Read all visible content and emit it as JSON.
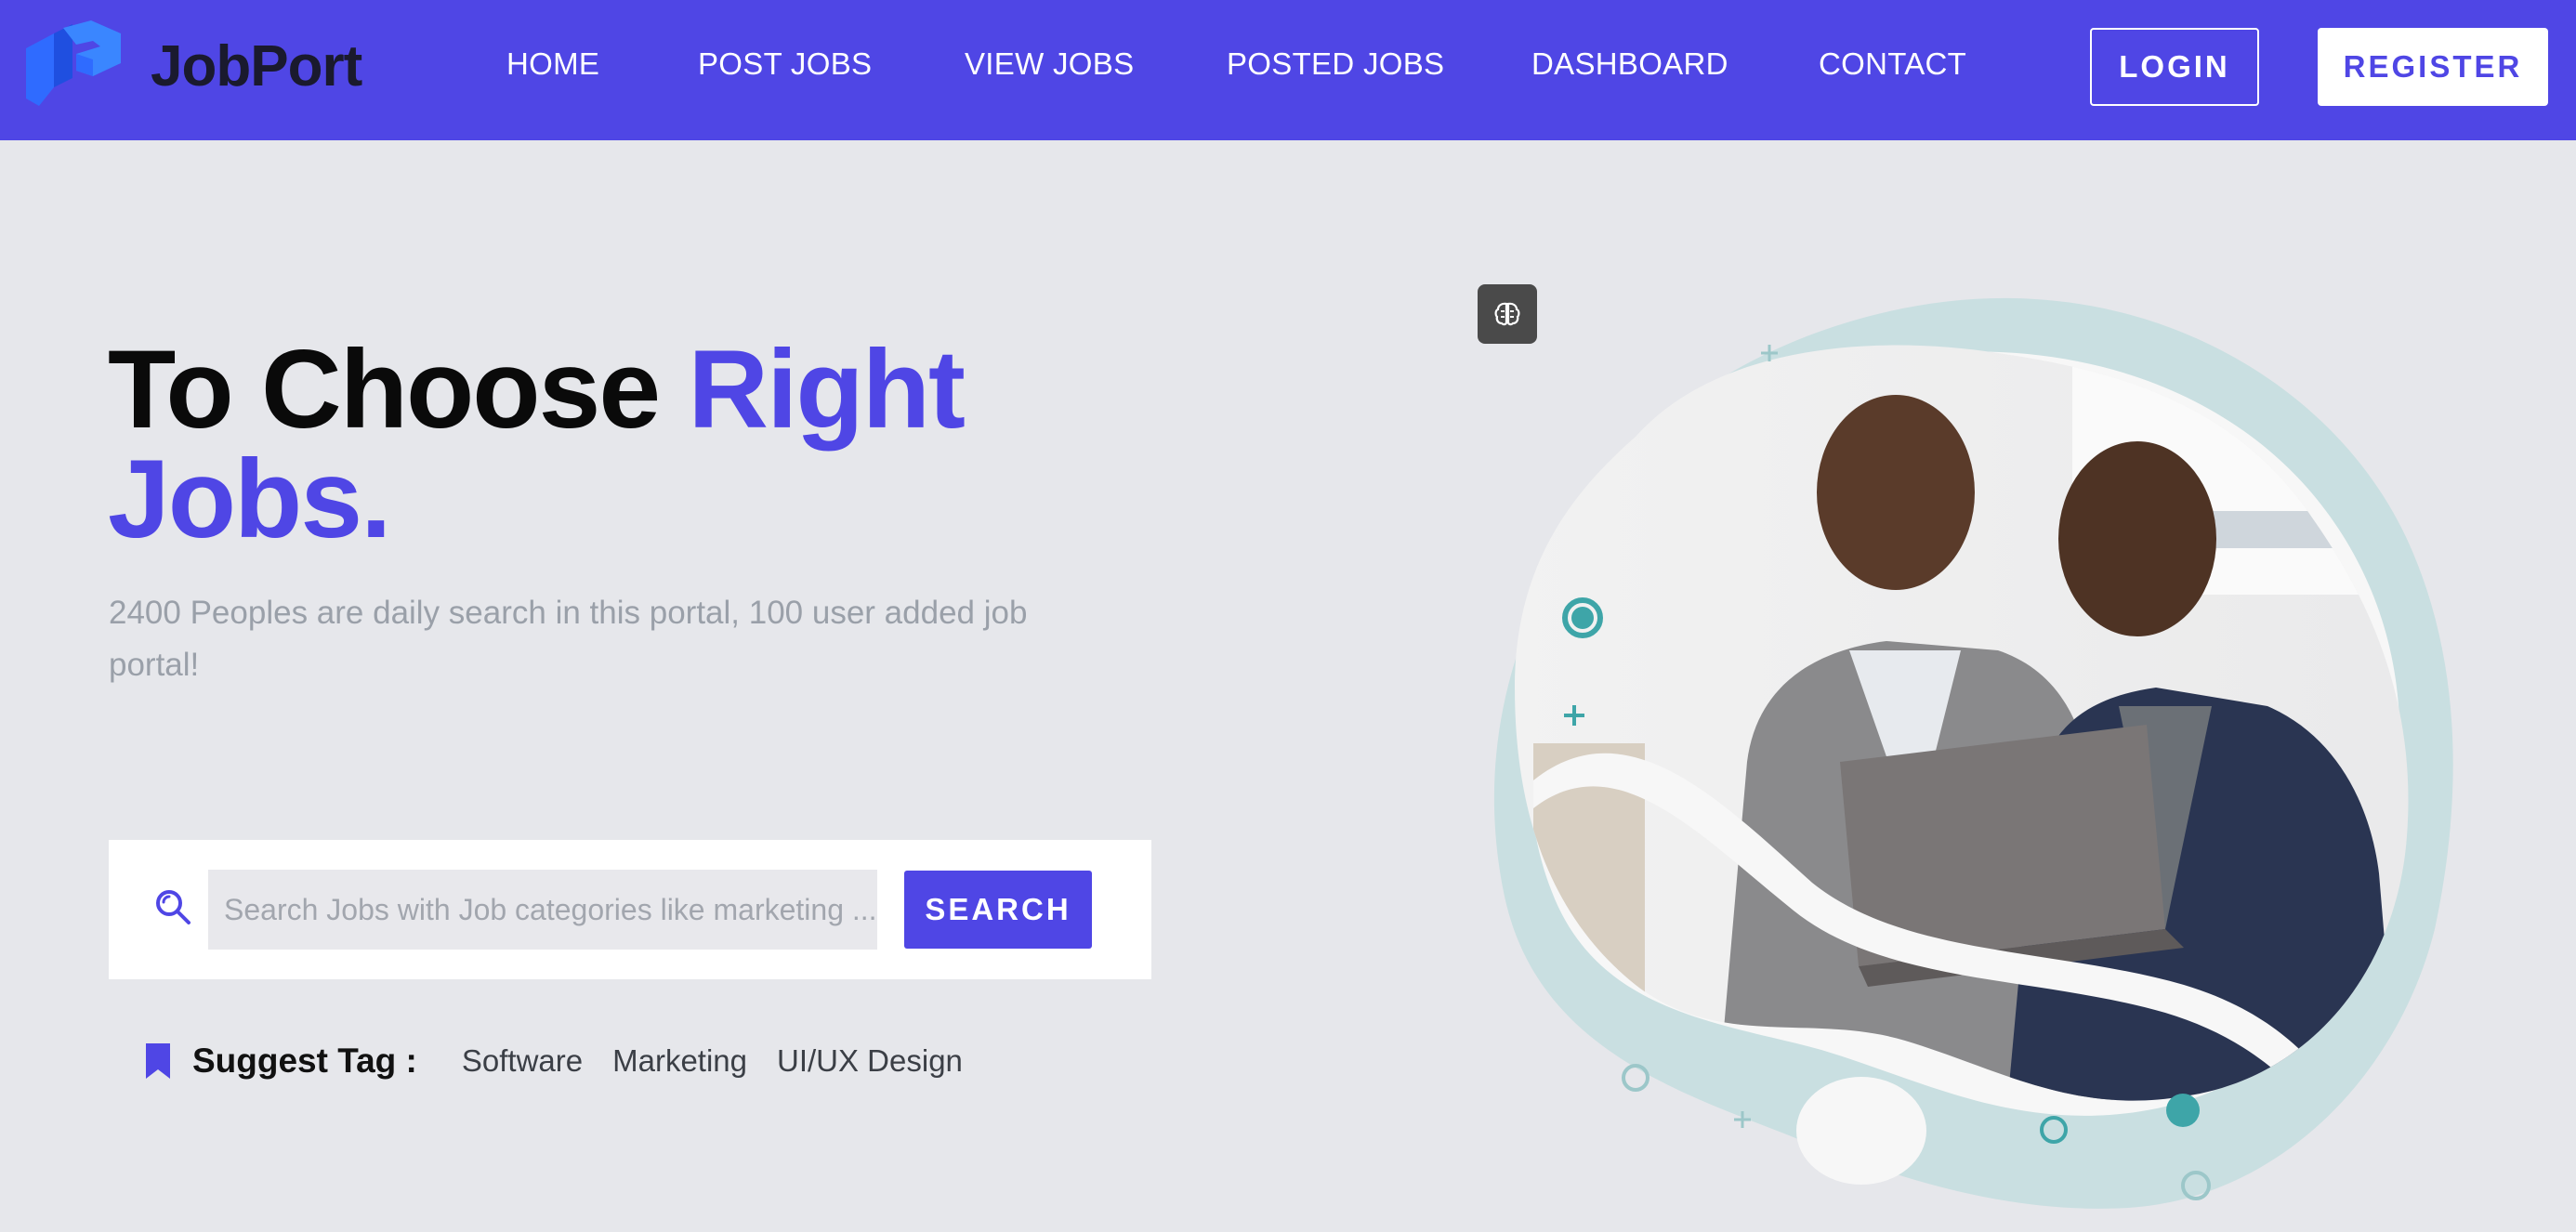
{
  "brand": {
    "name": "JobPort",
    "accent": "#4f46e5"
  },
  "nav": {
    "items": [
      {
        "label": "HOME"
      },
      {
        "label": "POST JOBS"
      },
      {
        "label": "VIEW JOBS"
      },
      {
        "label": "POSTED JOBS"
      },
      {
        "label": "DASHBOARD"
      },
      {
        "label": "CONTACT"
      }
    ],
    "login_label": "LOGIN",
    "register_label": "REGISTER"
  },
  "hero": {
    "title_plain": "To Choose ",
    "title_accent_1": "Right",
    "title_accent_2": "Jobs.",
    "subtitle": "2400 Peoples are daily search in this portal, 100 user added job portal!"
  },
  "search": {
    "placeholder": "Search Jobs with Job categories like marketing ...",
    "value": "",
    "button_label": "SEARCH"
  },
  "tags": {
    "label": "Suggest Tag :",
    "items": [
      "Software",
      "Marketing",
      "UI/UX Design"
    ]
  },
  "icons": {
    "logo": "jobport-logo-icon",
    "search": "search-icon",
    "bookmark": "bookmark-icon",
    "badge": "brain-icon"
  }
}
